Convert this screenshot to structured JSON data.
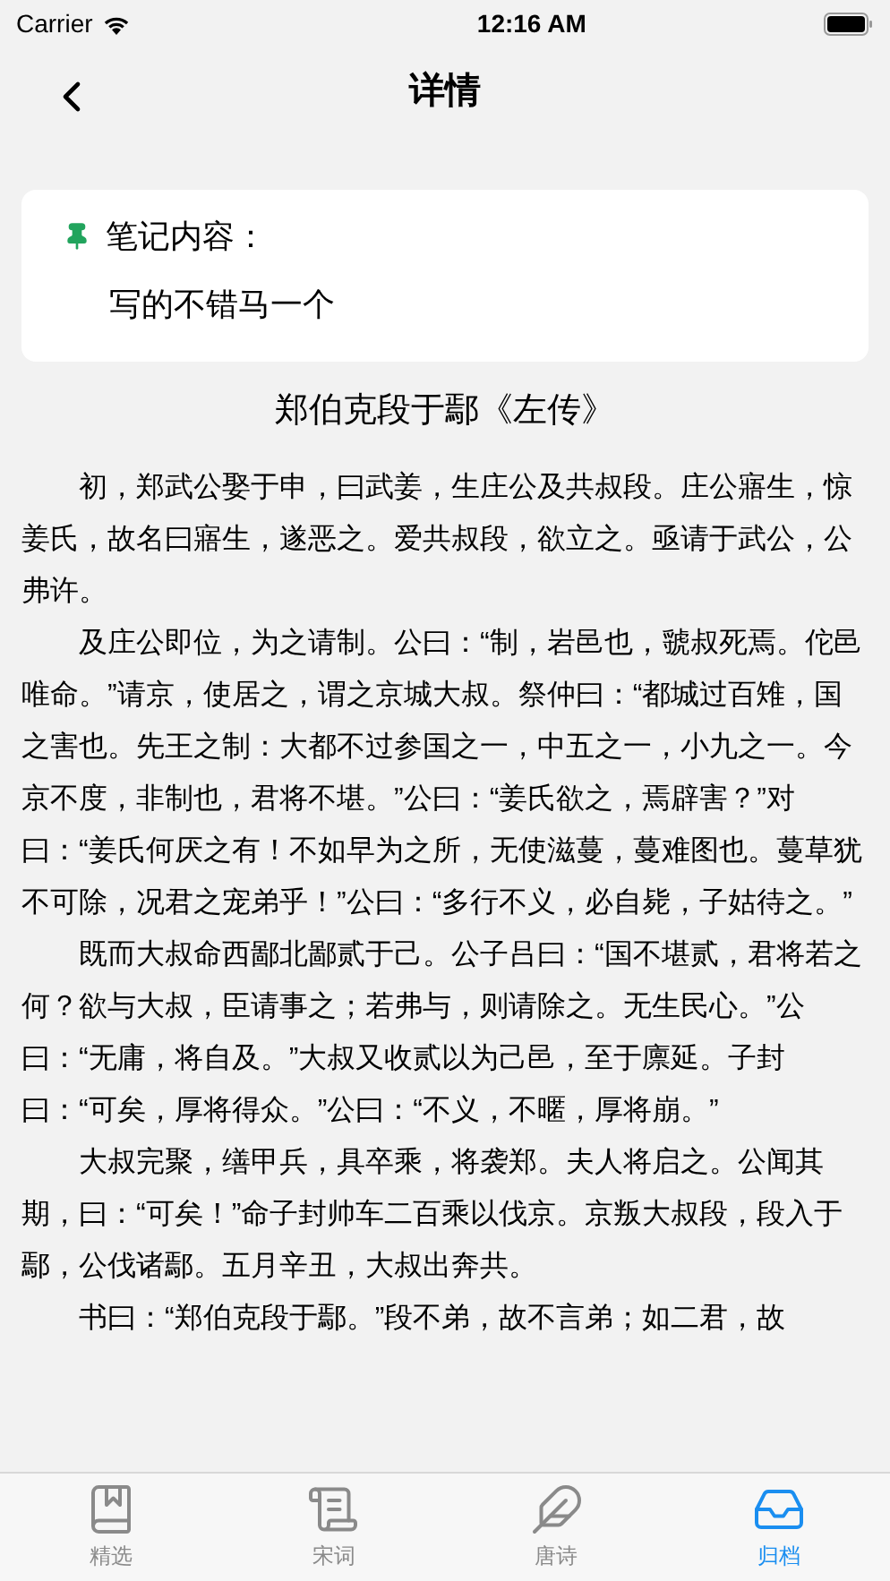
{
  "status_bar": {
    "carrier": "Carrier",
    "time": "12:16 AM"
  },
  "nav": {
    "title": "详情"
  },
  "note": {
    "label": "笔记内容：",
    "content": "写的不错马一个"
  },
  "article": {
    "title": "郑伯克段于鄢《左传》",
    "paragraphs": [
      "初，郑武公娶于申，曰武姜，生庄公及共叔段。庄公寤生，惊姜氏，故名曰寤生，遂恶之。爱共叔段，欲立之。亟请于武公，公弗许。",
      "及庄公即位，为之请制。公曰：“制，岩邑也，虢叔死焉。佗邑唯命。”请京，使居之，谓之京城大叔。祭仲曰：“都城过百雉，国之害也。先王之制：大都不过参国之一，中五之一，小九之一。今京不度，非制也，君将不堪。”公曰：“姜氏欲之，焉辟害？”对曰：“姜氏何厌之有！不如早为之所，无使滋蔓，蔓难图也。蔓草犹不可除，况君之宠弟乎！”公曰：“多行不义，必自毙，子姑待之。”",
      "既而大叔命西鄙北鄙贰于己。公子吕曰：“国不堪贰，君将若之何？欲与大叔，臣请事之；若弗与，则请除之。无生民心。”公曰：“无庸，将自及。”大叔又收贰以为己邑，至于廪延。子封曰：“可矣，厚将得众。”公曰：“不义，不暱，厚将崩。”",
      "大叔完聚，缮甲兵，具卒乘，将袭郑。夫人将启之。公闻其期，曰：“可矣！”命子封帅车二百乘以伐京。京叛大叔段，段入于鄢，公伐诸鄢。五月辛丑，大叔出奔共。",
      "书曰：“郑伯克段于鄢。”段不弟，故不言弟；如二君，故"
    ]
  },
  "tabs": [
    {
      "kind": "book",
      "label": "精选",
      "selected": false
    },
    {
      "kind": "scroll",
      "label": "宋词",
      "selected": false
    },
    {
      "kind": "feather",
      "label": "唐诗",
      "selected": false
    },
    {
      "kind": "inbox",
      "label": "归档",
      "selected": true
    }
  ]
}
